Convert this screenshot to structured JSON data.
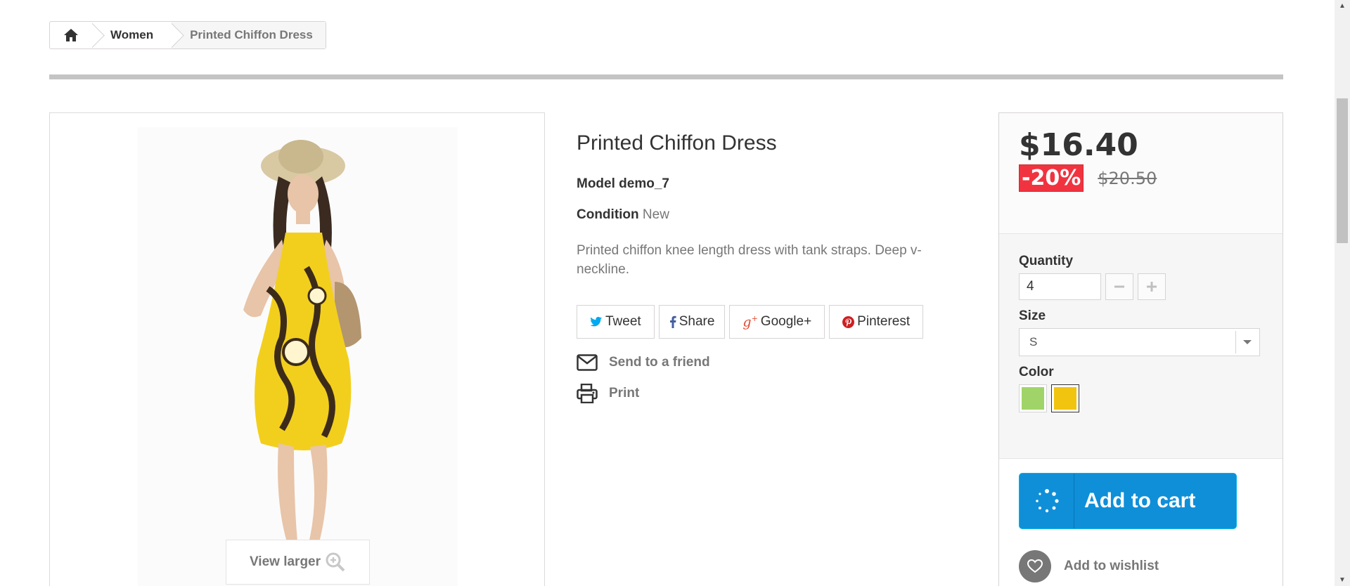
{
  "breadcrumb": {
    "home_icon": "home-icon",
    "category": "Women",
    "current": "Printed Chiffon Dress"
  },
  "product": {
    "image_button": "View larger",
    "title": "Printed Chiffon Dress",
    "model_label": "Model",
    "model_value": "demo_7",
    "condition_label": "Condition",
    "condition_value": "New",
    "description": "Printed chiffon knee length dress with tank straps. Deep v-neckline."
  },
  "share": [
    {
      "label": "Tweet",
      "icon": "twitter-icon",
      "color": "#00aaf0"
    },
    {
      "label": "Share",
      "icon": "facebook-icon",
      "color": "#435f9f"
    },
    {
      "label": "Google+",
      "icon": "google-plus-icon",
      "color": "#e04b34"
    },
    {
      "label": "Pinterest",
      "icon": "pinterest-icon",
      "color": "#ce1f21"
    }
  ],
  "links": {
    "send_friend": "Send to a friend",
    "print": "Print"
  },
  "buy": {
    "price": "$16.40",
    "discount": "-20%",
    "old_price": "$20.50",
    "quantity_label": "Quantity",
    "quantity_value": "4",
    "size_label": "Size",
    "size_value": "S",
    "color_label": "Color",
    "colors": [
      "#A0D468",
      "#F1C40F"
    ],
    "selected_color_index": 1,
    "add_to_cart": "Add to cart",
    "add_to_wishlist": "Add to wishlist"
  },
  "colors": {
    "accent_blue": "#0f8fd8",
    "discount_red": "#f13340"
  }
}
